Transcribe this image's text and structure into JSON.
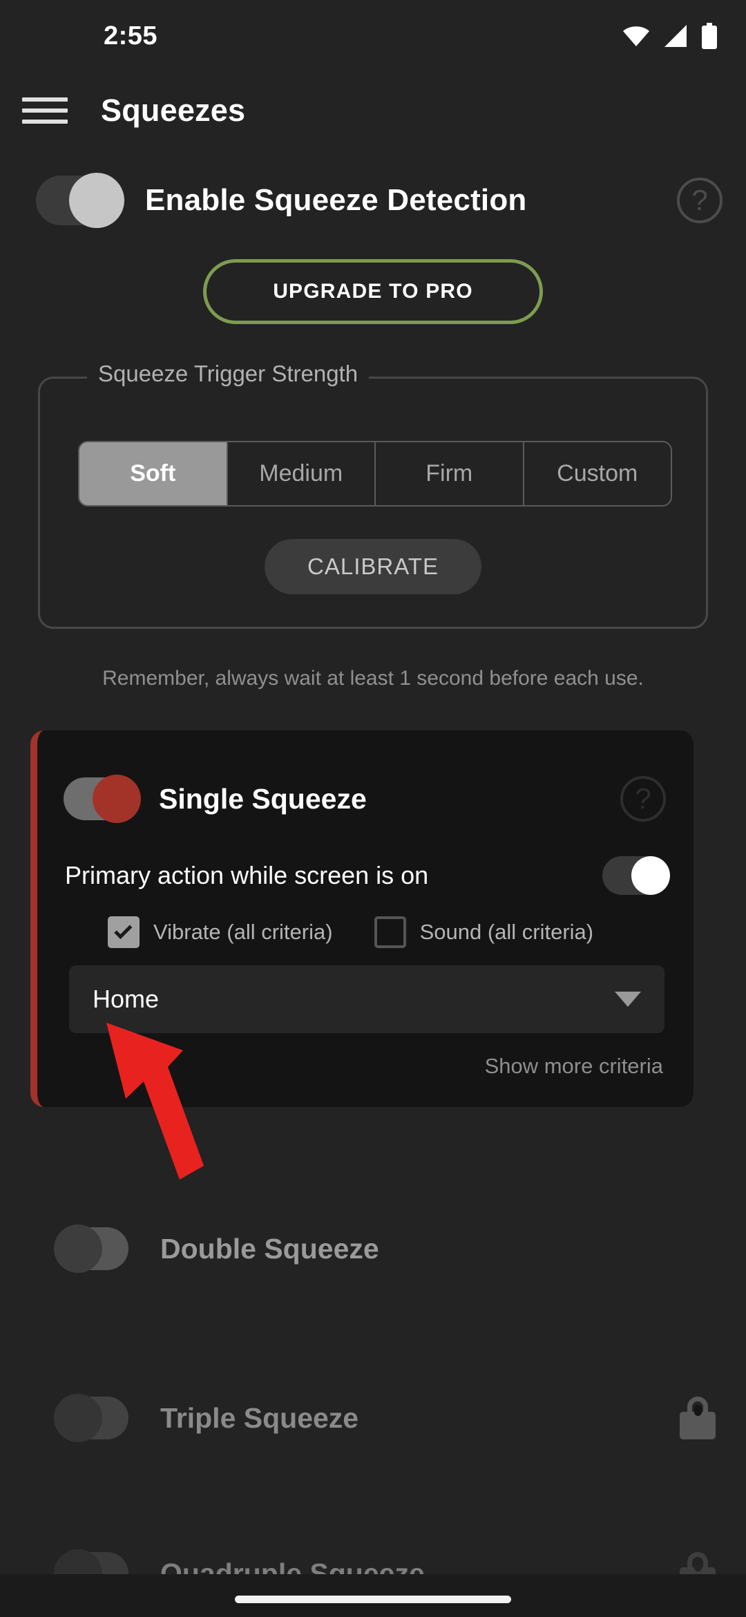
{
  "status_bar": {
    "time": "2:55",
    "icons": [
      "wifi-icon",
      "cellular-signal-icon",
      "battery-icon"
    ]
  },
  "app_bar": {
    "menu_icon": "hamburger-menu-icon",
    "title": "Squeezes"
  },
  "master": {
    "label": "Enable Squeeze Detection",
    "toggle_state": "on",
    "help_icon": "help-circle-icon"
  },
  "upgrade": {
    "label": "UPGRADE TO PRO",
    "border_color": "#7e9c4f"
  },
  "trigger_strength": {
    "legend": "Squeeze Trigger Strength",
    "options": [
      "Soft",
      "Medium",
      "Firm",
      "Custom"
    ],
    "selected": "Soft",
    "calibrate_label": "CALIBRATE"
  },
  "note": "Remember, always wait at least 1 second before each use.",
  "single_squeeze": {
    "title": "Single Squeeze",
    "toggle_state": "on",
    "accent_color": "#a33229",
    "help_icon": "help-circle-icon",
    "primary_action": {
      "label": "Primary action while screen is on",
      "toggle_state": "on"
    },
    "criteria": [
      {
        "label": "Vibrate (all criteria)",
        "checked": true
      },
      {
        "label": "Sound (all criteria)",
        "checked": false
      }
    ],
    "action_dropdown": {
      "value": "Home",
      "caret_icon": "chevron-down-icon"
    },
    "show_more_label": "Show more criteria"
  },
  "other_squeezes": [
    {
      "title": "Double Squeeze",
      "toggle_state": "off",
      "locked": false,
      "text_color": "#9a9a9a"
    },
    {
      "title": "Triple Squeeze",
      "toggle_state": "off",
      "locked": true,
      "text_color": "#8a8a8a"
    },
    {
      "title": "Quadruple Squeeze",
      "toggle_state": "off",
      "locked": true,
      "text_color": "#7e7e7e"
    }
  ],
  "annotation": {
    "type": "red-arrow",
    "color": "#e8231f",
    "points_to": "action-dropdown"
  },
  "navigation_bar": {
    "gesture_pill": "home-gesture-pill"
  }
}
